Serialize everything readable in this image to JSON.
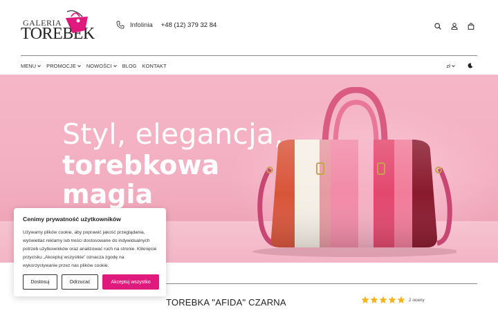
{
  "header": {
    "logo_top": "GALERIA",
    "logo_main": "TOREBEK",
    "contact_label": "Infolinia",
    "phone": "+48 (12) 379 32 84",
    "icons": [
      "search-icon",
      "user-icon",
      "bag-icon"
    ]
  },
  "nav": {
    "items": [
      {
        "label": "MENU",
        "dropdown": true
      },
      {
        "label": "PROMOCJE",
        "dropdown": true
      },
      {
        "label": "NOWOŚCI",
        "dropdown": true
      },
      {
        "label": "BLOG",
        "dropdown": false
      },
      {
        "label": "KONTAKT",
        "dropdown": false
      }
    ],
    "currency": "zł",
    "theme_icon": "moon-icon"
  },
  "hero": {
    "line1": "Styl, elegancja,",
    "line2": "torebkowa",
    "line3": "magia"
  },
  "cookie": {
    "title": "Cenimy prywatność użytkowników",
    "text": "Używamy plików cookie, aby poprawić jakość przeglądania, wyświetlać reklamy lub treści dostosowane do indywidualnych potrzeb użytkowników oraz analizować ruch na stronie. Kliknięcie przycisku „Akceptuj wszystkie” oznacza zgodę na wykorzystywanie przez nas plików cookie.",
    "btn_customize": "Dostosuj",
    "btn_reject": "Odrzucać",
    "btn_accept": "Akceptuj wszystko"
  },
  "product": {
    "title": "TOREBKA \"AFIDA\" CZARNA",
    "rating": 5,
    "reviews": "2 oceny"
  },
  "colors": {
    "accent": "#e0197d",
    "hero_bg": "#f3afc2",
    "star": "#f4b41a"
  }
}
